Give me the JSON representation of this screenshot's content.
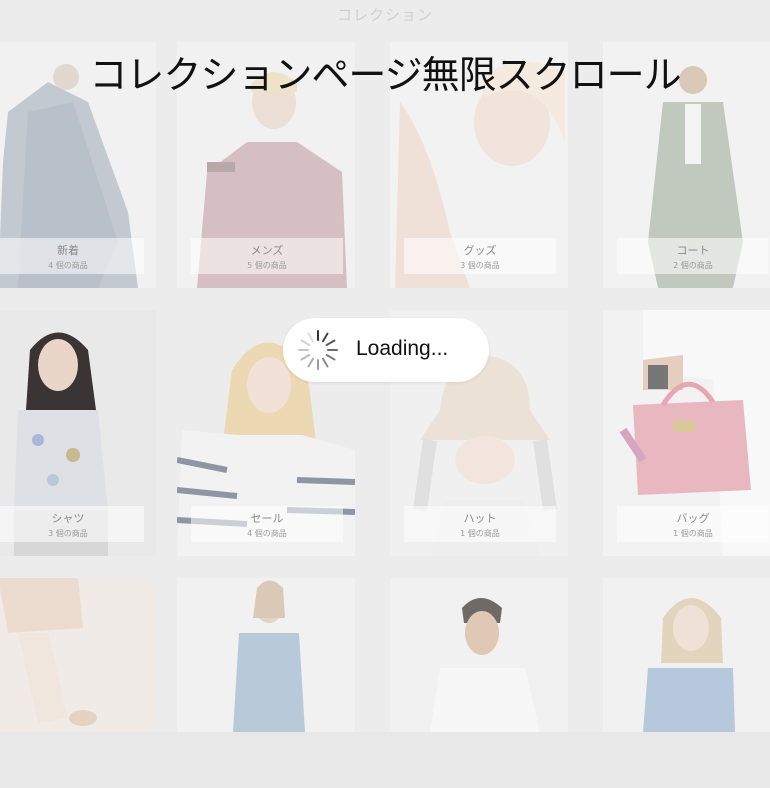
{
  "header": {
    "title": "コレクション"
  },
  "banner": {
    "title": "コレクションページ無限スクロール"
  },
  "loading": {
    "text": "Loading..."
  },
  "collections_row1": [
    {
      "name": "新着",
      "count": "4 個の商品"
    },
    {
      "name": "メンズ",
      "count": "5 個の商品"
    },
    {
      "name": "グッズ",
      "count": "3 個の商品"
    },
    {
      "name": "コート",
      "count": "2 個の商品"
    }
  ],
  "collections_row2": [
    {
      "name": "シャツ",
      "count": "3 個の商品"
    },
    {
      "name": "セール",
      "count": "4 個の商品"
    },
    {
      "name": "ハット",
      "count": "1 個の商品"
    },
    {
      "name": "バッグ",
      "count": "1 個の商品"
    }
  ],
  "colors": {
    "accent": "#111111",
    "background": "#ececec",
    "card": "#f3f3f3"
  }
}
